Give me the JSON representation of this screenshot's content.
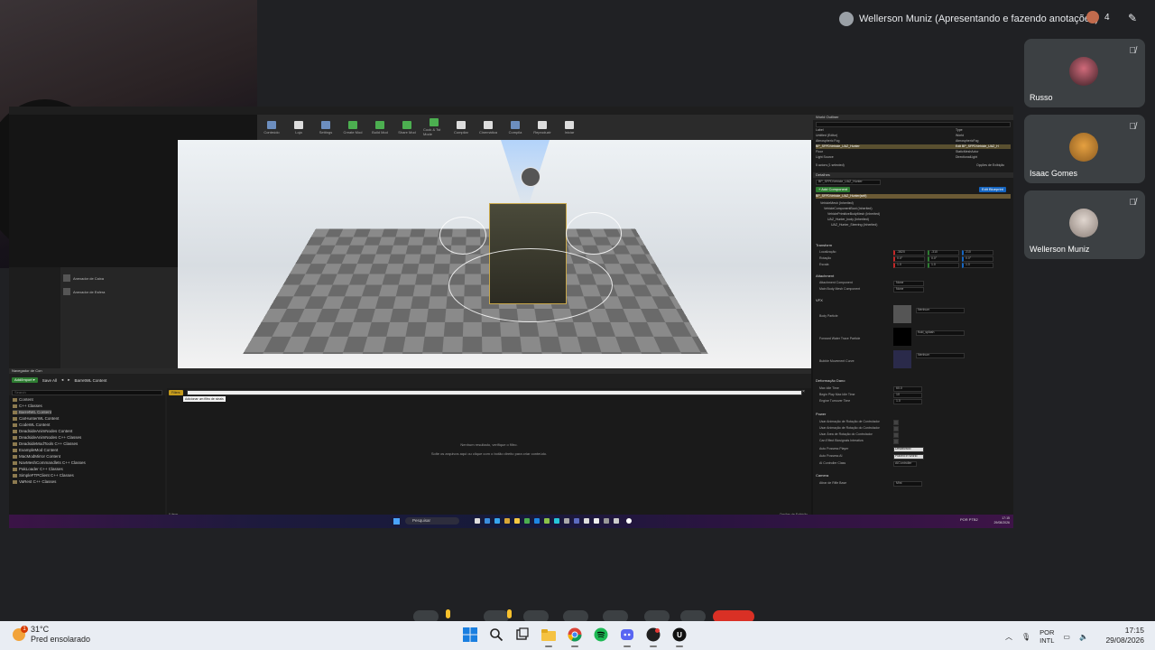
{
  "meet": {
    "presenter_label": "Wellerson Muniz (Apresentando e fazendo anotações)",
    "participant_count": "4",
    "participants": [
      {
        "name": "Russo",
        "muted": true
      },
      {
        "name": "Isaac Gomes",
        "muted": true
      },
      {
        "name": "Wellerson Muniz",
        "muted": true
      }
    ]
  },
  "unreal": {
    "left_panel_items": [
      "Anexador de Caixa",
      "Anexador de Esfera"
    ],
    "outliner": {
      "title": "World Outliner",
      "col_label": "Label",
      "col_type": "Type",
      "rows": [
        {
          "label": "Untitled (Editor)",
          "type": "World"
        },
        {
          "label": "Atmospheric Fog",
          "type": "AtmosphericFog"
        },
        {
          "label": "BP_SFPDVehicle_UAZ_Hunter",
          "type": "Edit BP_SFPDVehicle_UAZ_H"
        },
        {
          "label": "Floor",
          "type": "StaticMeshActor"
        },
        {
          "label": "Light Source",
          "type": "DirectionalLight"
        }
      ],
      "footer": "5 actors (1 selected)",
      "view_options": "Opções de Exibição"
    },
    "details": {
      "title": "Detalhes",
      "actor_name": "BP_SFPDVehicle_UAZ_Hunter",
      "add_component": "+ Add Component",
      "edit_blueprint": "Edit Blueprint",
      "component_header": "BP_SFPDVehicle_UAZ_Hunter(self)",
      "components": [
        "VehicleMesh (Inherited)",
        "VehicleComponentBoot (Inherited)",
        "VehiclePrimitiveBodyMesh (Inherited)",
        "UAZ_Hunter_body (Inherited)",
        "UAZ_Hunter_Steering (Inherited)"
      ],
      "sections": {
        "transform": "Transform",
        "attachment": "Attachment",
        "vfx": "VFX",
        "deforms": "Deformação Dano",
        "power": "Power",
        "camera": "Camera"
      },
      "transform_labels": [
        "Localização",
        "Rotação",
        "Escala"
      ],
      "transform_values": [
        [
          "-3820",
          "-310",
          "210"
        ],
        [
          "0.0°",
          "0.0°",
          "0.0°"
        ],
        [
          "1.0",
          "1.0",
          "1.0"
        ]
      ],
      "attachment_fields": [
        "Attachment Component",
        "Main Body Mesh Component"
      ],
      "attachment_value": "None",
      "vfx_fields": [
        "Body Particle",
        "Forward Water Trace Particle",
        "Bubble Movement Curve"
      ],
      "vfx_values": [
        "Nenhum",
        "fluid_splash",
        "Nenhum"
      ],
      "deform_fields": [
        "Max Idle Time",
        "Begin Play Max Idle Time",
        "Engine Turnover Time"
      ],
      "deform_values": [
        "60.0",
        "10",
        "1.0"
      ],
      "power_fields": [
        "Usar Animação de Rotação de Controlador",
        "Usar Animação de Rotação do Controlador",
        "Usar Área de Rotação do Controlador",
        "Can Effect Biosignals Interativa",
        "Auto Possess Player",
        "Auto Possess AI",
        "AI Controller Class"
      ],
      "power_values": [
        "Desativado",
        "Placed in World",
        "AIController"
      ],
      "camera_field": "Atirar de Rifle Base",
      "camera_value": "Mini"
    },
    "content_browser": {
      "tab": "Navegador de Con",
      "add_import": "Add/Import ▾",
      "save_all": "Save All",
      "path": "BarretWL Content",
      "search_placeholder": "Search",
      "filter_tag": "Filters",
      "tooltip": "Adicionar um filtro de sinais",
      "tree": [
        "Content",
        "C++ Classes",
        "BarretWL Content",
        "CarHunterWL Content",
        "CodeWL Content",
        "DeadsideAnimNodes Content",
        "DeadsideAnimNodes C++ Classes",
        "DeadsideModTools C++ Classes",
        "ExampleMod Content",
        "MacModMirror Content",
        "NavMeshCommandlets C++ Classes",
        "PakLoader C++ Classes",
        "SimpleFTPClient C++ Classes",
        "VaRest C++ Classes"
      ],
      "empty_title": "Nenhum resultado, verifique o filtro.",
      "empty_sub": "Solte os arquivos aqui ou clique com o botão direito para criar conteúdo.",
      "item_count": "0 itens",
      "view_options": "Opções de Exibição"
    },
    "toolbar": [
      "Conteúdo",
      "Loja",
      "Settings",
      "Create Mod",
      "Build Mod",
      "Share Mod",
      "Cook & Tst Mode",
      "Compilar",
      "Cinemática",
      "Compila",
      "Reproduzir",
      "Iniciar"
    ],
    "taskbar_search": "Pesquisar",
    "taskbar_time": "17:15",
    "taskbar_date": "29/08/2026",
    "taskbar_lang": "POR PTB2"
  },
  "host_taskbar": {
    "weather_temp": "31°C",
    "weather_desc": "Pred ensolarado",
    "weather_badge": "1",
    "lang_top": "POR",
    "lang_bottom": "INTL",
    "time": "17:15",
    "date": "29/08/2026"
  },
  "colors": {
    "meet_bg": "#202124",
    "tile_bg": "#3c4043",
    "leave_red": "#d93025",
    "unreal_selection": "#5a5030",
    "host_taskbar": "#e9edf3"
  }
}
